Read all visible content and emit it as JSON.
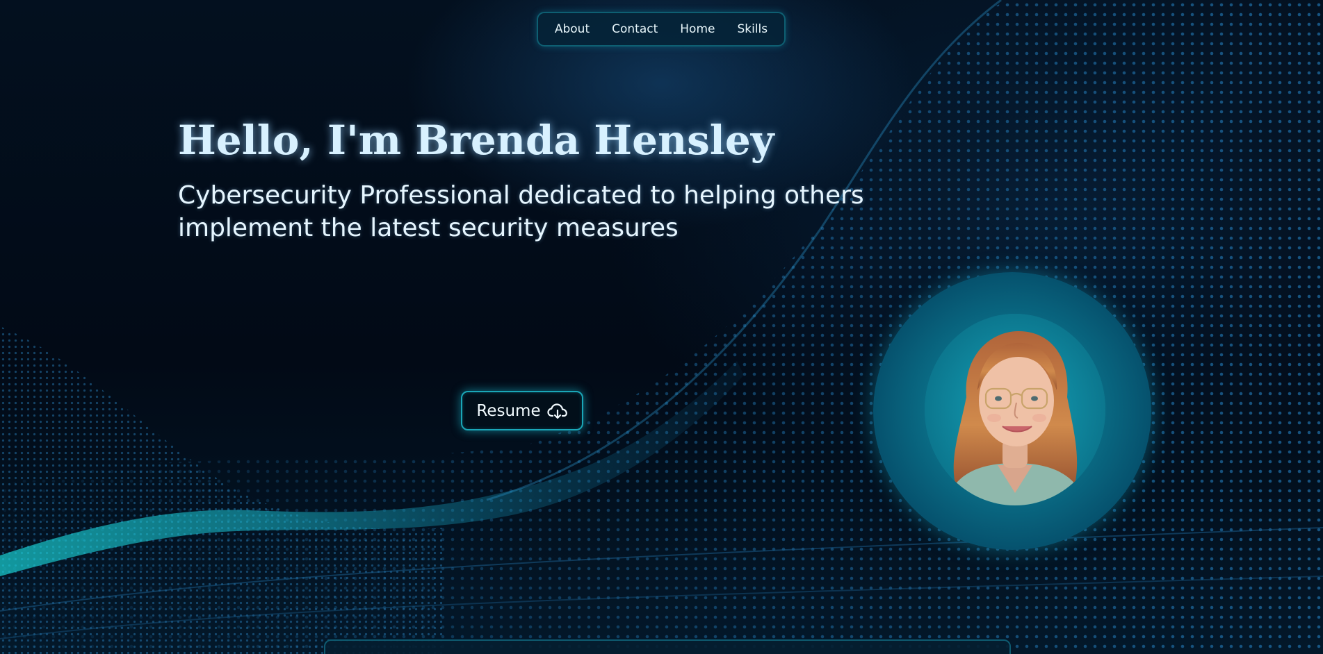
{
  "nav": {
    "items": [
      {
        "label": "About"
      },
      {
        "label": "Contact"
      },
      {
        "label": "Home"
      },
      {
        "label": "Skills"
      }
    ]
  },
  "hero": {
    "title": "Hello, I'm Brenda Hensley",
    "subtitle": "Cybersecurity Professional dedicated to helping others implement the latest security measures"
  },
  "resume_button": {
    "label": "Resume",
    "icon": "cloud-download-icon"
  },
  "profile": {
    "image": "profile-photo"
  },
  "colors": {
    "background": "#020b18",
    "accent": "#1aa7b8",
    "title_text": "#d8f1ff",
    "wave": "#1f6fa8"
  }
}
